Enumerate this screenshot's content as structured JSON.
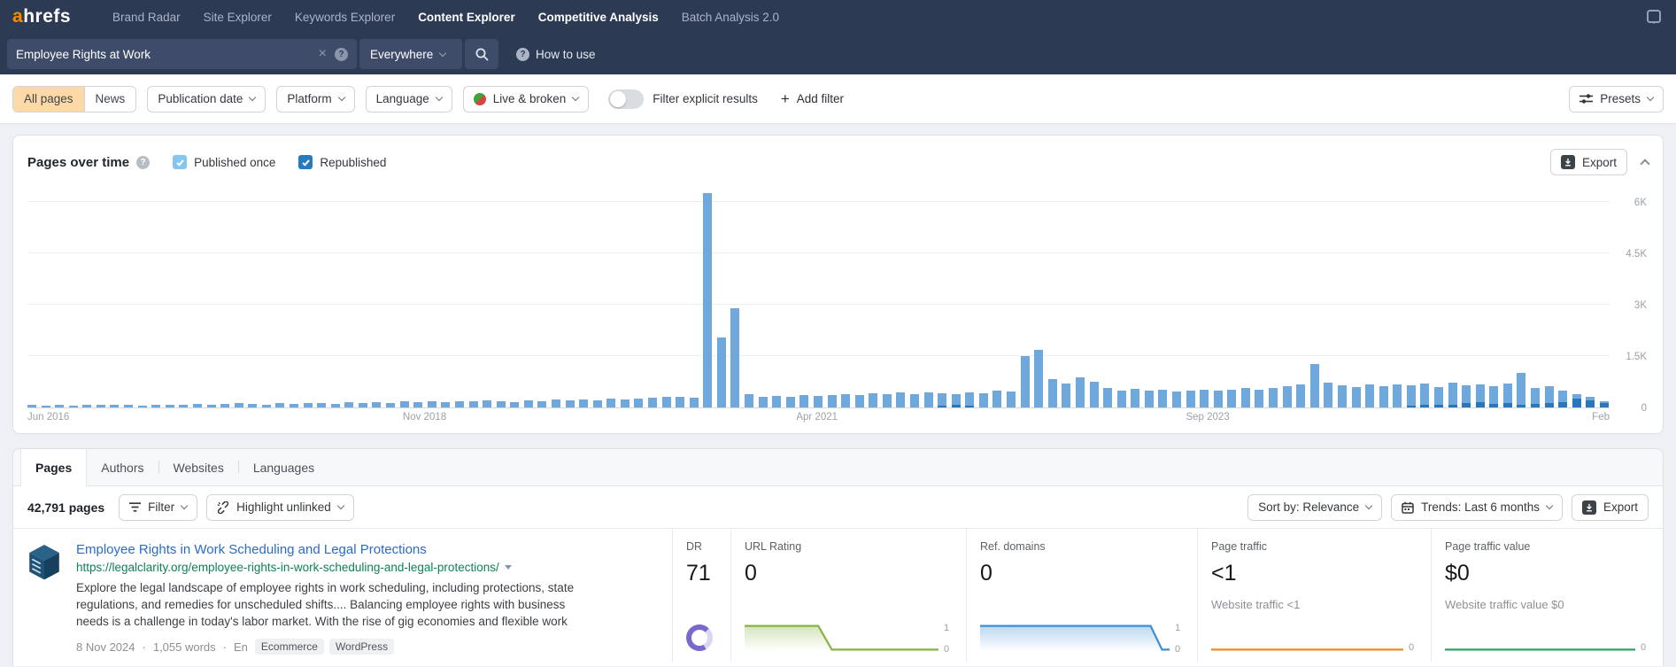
{
  "navbar": {
    "logo_a": "a",
    "logo_rest": "hrefs",
    "items": [
      {
        "label": "Brand Radar",
        "bright": false
      },
      {
        "label": "Site Explorer",
        "bright": false
      },
      {
        "label": "Keywords Explorer",
        "bright": false
      },
      {
        "label": "Content Explorer",
        "bright": true
      },
      {
        "label": "Competitive Analysis",
        "bright": true
      },
      {
        "label": "Batch Analysis 2.0",
        "bright": false
      }
    ]
  },
  "search": {
    "query": "Employee Rights at Work",
    "scope": "Everywhere",
    "help_label": "How to use"
  },
  "filter_bar": {
    "segments": [
      {
        "label": "All pages",
        "active": true
      },
      {
        "label": "News",
        "active": false
      }
    ],
    "dropdowns": [
      {
        "label": "Publication date",
        "icon": ""
      },
      {
        "label": "Platform",
        "icon": ""
      },
      {
        "label": "Language",
        "icon": ""
      },
      {
        "label": "Live & broken",
        "icon": "live-broken"
      }
    ],
    "toggle_label": "Filter explicit results",
    "add_filter_label": "Add filter",
    "presets_label": "Presets"
  },
  "chart_panel": {
    "title": "Pages over time",
    "checkboxes": [
      {
        "label": "Published once",
        "checked": true,
        "color": "#85c6ef"
      },
      {
        "label": "Republished",
        "checked": true,
        "color": "#2779c0"
      }
    ],
    "export_label": "Export"
  },
  "chart_data": [
    {
      "id": "pages-over-time",
      "type": "bar",
      "title": "Pages over time",
      "series_names": [
        "Published once",
        "Republished"
      ],
      "x_ticks": [
        "Jun 2016",
        "Nov 2018",
        "Apr 2021",
        "Sep 2023",
        "Feb"
      ],
      "x_tick_positions": [
        0.004,
        0.251,
        0.499,
        0.746,
        0.995
      ],
      "y_ticks": [
        "0",
        "1.5K",
        "3K",
        "4.5K",
        "6K"
      ],
      "y_tick_values": [
        0,
        1500,
        3000,
        4500,
        6000
      ],
      "ylim": [
        0,
        6600
      ],
      "bar_colors": [
        "#6fa8dc",
        "#2a76ba"
      ],
      "bars": [
        [
          70,
          0
        ],
        [
          55,
          0
        ],
        [
          80,
          0
        ],
        [
          60,
          0
        ],
        [
          75,
          0
        ],
        [
          65,
          0
        ],
        [
          85,
          0
        ],
        [
          70,
          0
        ],
        [
          60,
          0
        ],
        [
          80,
          0
        ],
        [
          90,
          0
        ],
        [
          75,
          0
        ],
        [
          110,
          0
        ],
        [
          85,
          0
        ],
        [
          95,
          0
        ],
        [
          120,
          0
        ],
        [
          100,
          0
        ],
        [
          90,
          0
        ],
        [
          130,
          0
        ],
        [
          110,
          0
        ],
        [
          140,
          0
        ],
        [
          120,
          0
        ],
        [
          100,
          0
        ],
        [
          150,
          0
        ],
        [
          130,
          0
        ],
        [
          160,
          0
        ],
        [
          140,
          0
        ],
        [
          170,
          0
        ],
        [
          150,
          0
        ],
        [
          180,
          0
        ],
        [
          160,
          0
        ],
        [
          190,
          0
        ],
        [
          170,
          0
        ],
        [
          200,
          0
        ],
        [
          180,
          0
        ],
        [
          160,
          0
        ],
        [
          210,
          0
        ],
        [
          190,
          0
        ],
        [
          220,
          0
        ],
        [
          200,
          0
        ],
        [
          230,
          0
        ],
        [
          210,
          0
        ],
        [
          250,
          0
        ],
        [
          240,
          0
        ],
        [
          260,
          0
        ],
        [
          280,
          0
        ],
        [
          300,
          0
        ],
        [
          320,
          0
        ],
        [
          280,
          0
        ],
        [
          6250,
          0
        ],
        [
          2050,
          0
        ],
        [
          2900,
          0
        ],
        [
          380,
          0
        ],
        [
          300,
          0
        ],
        [
          340,
          0
        ],
        [
          310,
          0
        ],
        [
          360,
          0
        ],
        [
          330,
          0
        ],
        [
          350,
          0
        ],
        [
          400,
          0
        ],
        [
          370,
          0
        ],
        [
          420,
          0
        ],
        [
          390,
          0
        ],
        [
          430,
          0
        ],
        [
          380,
          0
        ],
        [
          440,
          0
        ],
        [
          410,
          60
        ],
        [
          390,
          80
        ],
        [
          450,
          50
        ],
        [
          420,
          0
        ],
        [
          480,
          0
        ],
        [
          460,
          0
        ],
        [
          1500,
          0
        ],
        [
          1680,
          0
        ],
        [
          820,
          0
        ],
        [
          700,
          0
        ],
        [
          880,
          0
        ],
        [
          760,
          0
        ],
        [
          560,
          0
        ],
        [
          500,
          0
        ],
        [
          540,
          0
        ],
        [
          480,
          0
        ],
        [
          520,
          0
        ],
        [
          460,
          0
        ],
        [
          500,
          0
        ],
        [
          530,
          0
        ],
        [
          480,
          0
        ],
        [
          510,
          0
        ],
        [
          560,
          0
        ],
        [
          520,
          0
        ],
        [
          580,
          0
        ],
        [
          620,
          0
        ],
        [
          660,
          0
        ],
        [
          1260,
          0
        ],
        [
          720,
          0
        ],
        [
          640,
          0
        ],
        [
          600,
          0
        ],
        [
          660,
          0
        ],
        [
          620,
          0
        ],
        [
          680,
          0
        ],
        [
          650,
          60
        ],
        [
          700,
          80
        ],
        [
          600,
          70
        ],
        [
          720,
          90
        ],
        [
          640,
          120
        ],
        [
          680,
          150
        ],
        [
          620,
          100
        ],
        [
          700,
          130
        ],
        [
          1020,
          80
        ],
        [
          560,
          100
        ],
        [
          620,
          140
        ],
        [
          480,
          160
        ],
        [
          400,
          250
        ],
        [
          300,
          200
        ],
        [
          180,
          120
        ]
      ]
    },
    {
      "id": "url-rating-spark",
      "type": "area",
      "color": "#86b440",
      "points": [
        [
          0,
          1
        ],
        [
          0.38,
          1
        ],
        [
          0.45,
          0
        ],
        [
          1,
          0
        ]
      ],
      "y_labels": [
        "1",
        "0"
      ]
    },
    {
      "id": "ref-domains-spark",
      "type": "area",
      "color": "#3a8fd8",
      "points": [
        [
          0,
          1
        ],
        [
          0.9,
          1
        ],
        [
          0.96,
          0
        ],
        [
          1,
          0
        ]
      ],
      "y_labels": [
        "1",
        "0"
      ]
    },
    {
      "id": "page-traffic-spark",
      "type": "line",
      "color": "#ef8b1d",
      "points": [
        [
          0,
          0
        ],
        [
          1,
          0
        ]
      ],
      "y_labels": [
        "0"
      ]
    },
    {
      "id": "traffic-value-spark",
      "type": "line",
      "color": "#2da26b",
      "points": [
        [
          0,
          0
        ],
        [
          1,
          0
        ]
      ],
      "y_labels": [
        "0"
      ]
    }
  ],
  "results": {
    "tabs": [
      {
        "label": "Pages",
        "active": true
      },
      {
        "label": "Authors",
        "active": false
      },
      {
        "label": "Websites",
        "active": false
      },
      {
        "label": "Languages",
        "active": false
      }
    ],
    "toolbar": {
      "count": "42,791 pages",
      "filter_label": "Filter",
      "highlight_label": "Highlight unlinked",
      "sort_label": "Sort by: Relevance",
      "trends_label": "Trends: Last 6 months",
      "export_label": "Export"
    },
    "row": {
      "title": "Employee Rights in Work Scheduling and Legal Protections",
      "url": "https://legalclarity.org/employee-rights-in-work-scheduling-and-legal-protections/",
      "description": "Explore the legal landscape of employee rights in work scheduling, including protections, state regulations, and remedies for unscheduled shifts.... Balancing employee rights with business needs is a challenge in today's labor market. With the rise of gig economies and flexible work",
      "date": "8 Nov 2024",
      "words": "1,055 words",
      "lang": "En",
      "separator": "·",
      "badges": [
        "Ecommerce",
        "WordPress"
      ],
      "metrics": {
        "dr": {
          "label": "DR",
          "value": "71",
          "donut_pct": 71,
          "donut_color": "#7a68ce",
          "donut_track": "#dcd6f2"
        },
        "url_rating": {
          "label": "URL Rating",
          "value": "0"
        },
        "ref_domains": {
          "label": "Ref. domains",
          "value": "0"
        },
        "page_traffic": {
          "label": "Page traffic",
          "value": "<1",
          "sub": "Website traffic <1"
        },
        "page_traffic_value": {
          "label": "Page traffic value",
          "value": "$0",
          "sub": "Website traffic value $0"
        }
      }
    }
  }
}
